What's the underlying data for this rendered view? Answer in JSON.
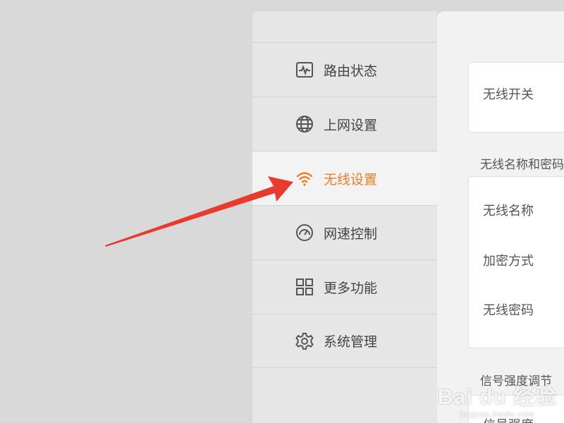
{
  "sidebar": {
    "items": [
      {
        "label": "路由状态",
        "icon": "activity-monitor-icon",
        "active": false
      },
      {
        "label": "上网设置",
        "icon": "globe-icon",
        "active": false
      },
      {
        "label": "无线设置",
        "icon": "wifi-icon",
        "active": true
      },
      {
        "label": "网速控制",
        "icon": "speedometer-icon",
        "active": false
      },
      {
        "label": "更多功能",
        "icon": "grid-icon",
        "active": false
      },
      {
        "label": "系统管理",
        "icon": "gear-icon",
        "active": false
      }
    ]
  },
  "main": {
    "wireless_switch_label": "无线开关",
    "section_name_password": "无线名称和密码",
    "ssid_label": "无线名称",
    "encryption_label": "加密方式",
    "password_label": "无线密码",
    "section_signal": "信号强度调节",
    "signal_label": "信号强度"
  },
  "watermark": {
    "logo": "Bai du 经验",
    "sub": "jingyan.baidu.com"
  },
  "colors": {
    "accent": "#ee7d24",
    "arrow": "#e83a2e",
    "sidebar_bg": "#e6e6e6",
    "active_bg": "#f3f3f3"
  }
}
